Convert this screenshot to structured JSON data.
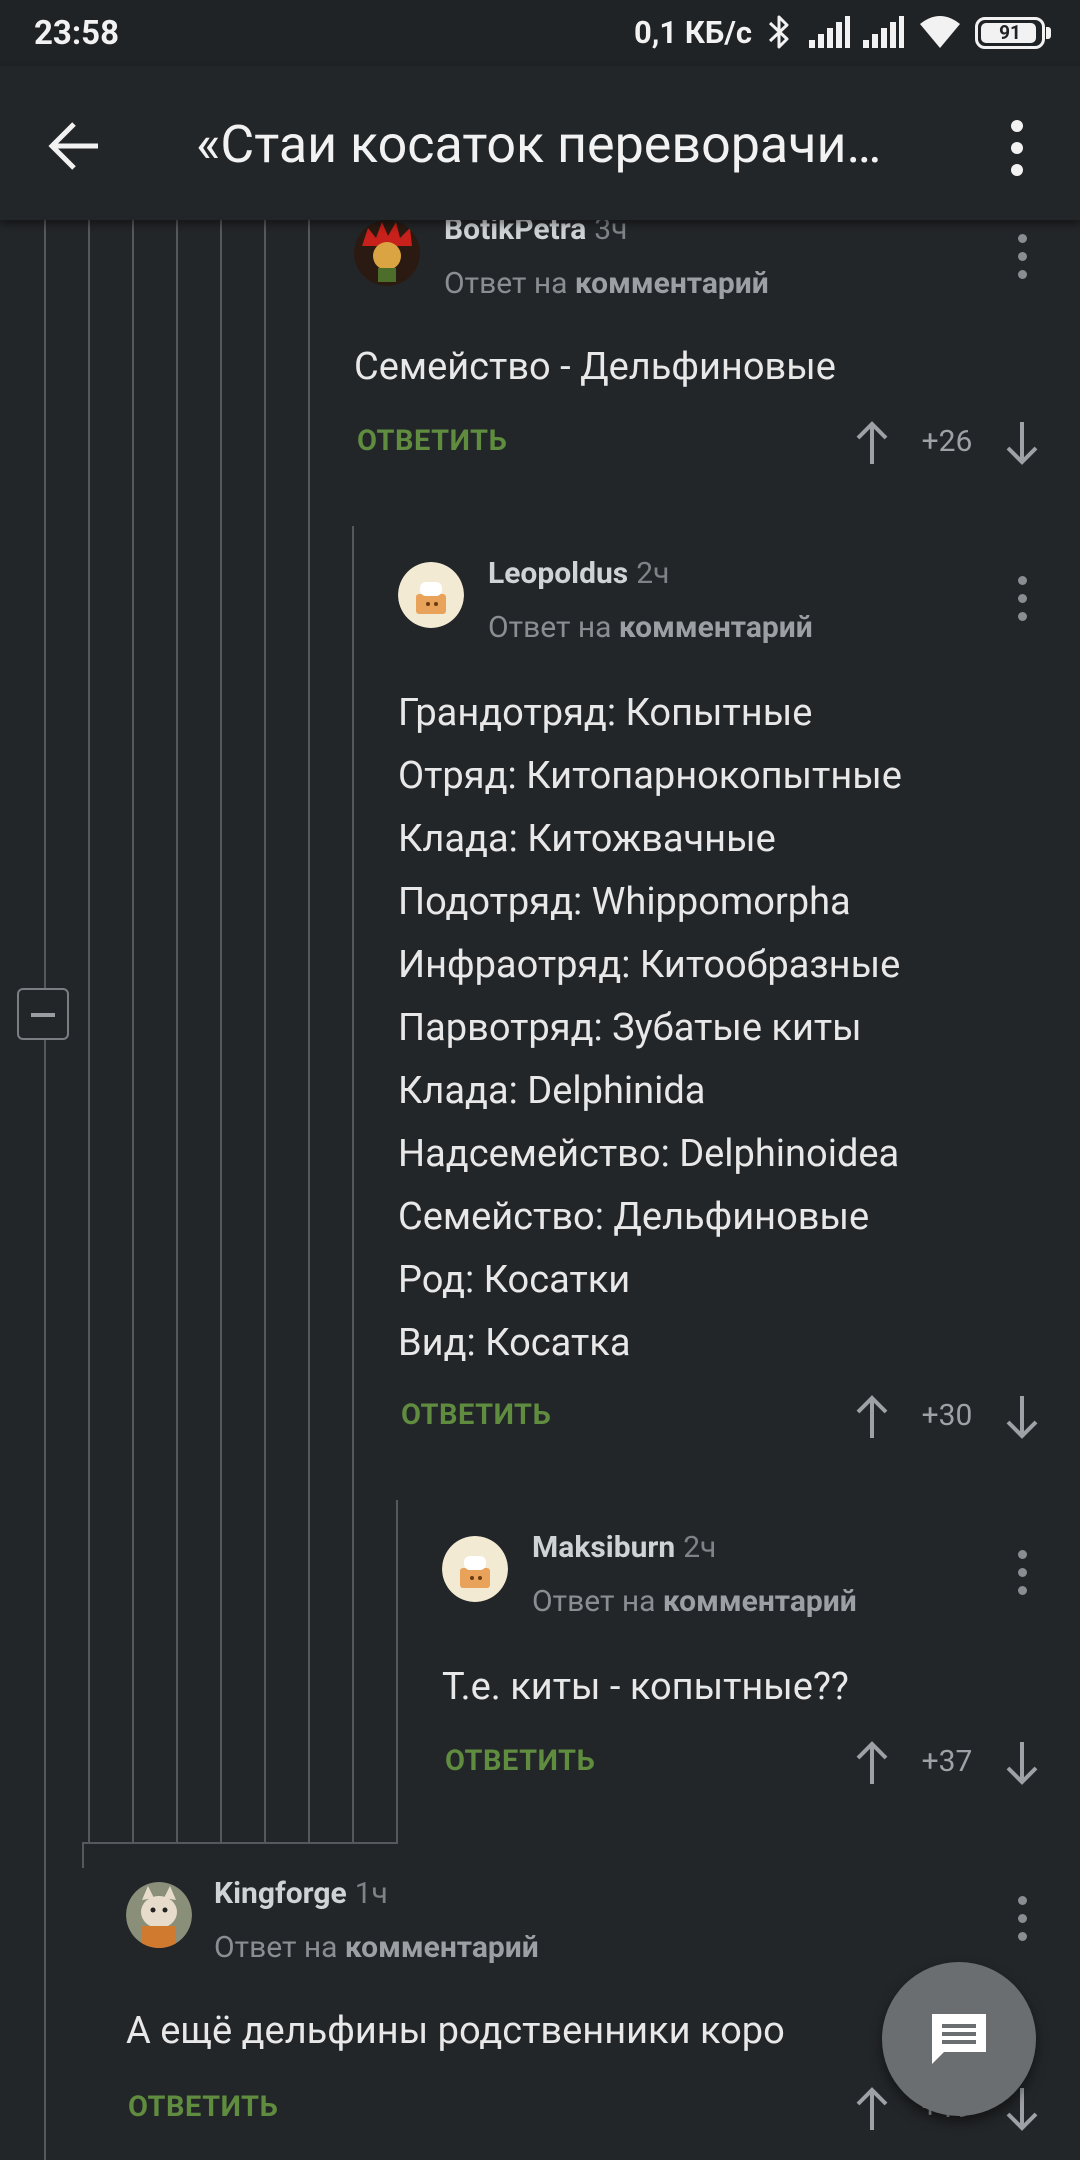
{
  "status_bar": {
    "time": "23:58",
    "network_speed": "0,1 КБ/с",
    "battery_level": "91"
  },
  "app_bar": {
    "title": "«Стаи косаток переворачи…"
  },
  "comments": [
    {
      "author": "BotikPetra",
      "time": "3ч",
      "reply_prefix": "Ответ на",
      "reply_target": "комментарий",
      "lines": [
        "Семейство - Дельфиновые"
      ],
      "reply_label": "ОТВЕТИТЬ",
      "score": "+26"
    },
    {
      "author": "Leopoldus",
      "time": "2ч",
      "reply_prefix": "Ответ на",
      "reply_target": "комментарий",
      "lines": [
        "Грандотряд: Копытные",
        "Отряд: Китопарнокопытные",
        "Клада: Китожвачные",
        "Подотряд: Whippomorpha",
        "Инфраотряд: Китообразные",
        "Парвотряд: Зубатые киты",
        "Клада: Delphinida",
        "Надсемейство: Delphinoidea",
        "Семейство: Дельфиновые",
        "Род: Косатки",
        "Вид: Косатка"
      ],
      "reply_label": "ОТВЕТИТЬ",
      "score": "+30"
    },
    {
      "author": "Maksiburn",
      "time": "2ч",
      "reply_prefix": "Ответ на",
      "reply_target": "комментарий",
      "lines": [
        "Т.е. киты - копытные??"
      ],
      "reply_label": "ОТВЕТИТЬ",
      "score": "+37"
    },
    {
      "author": "Kingforge",
      "time": "1ч",
      "reply_prefix": "Ответ на",
      "reply_target": "комментарий",
      "lines": [
        "А ещё дельфины родственники коро"
      ],
      "reply_label": "ОТВЕТИТЬ",
      "score": "+19"
    }
  ],
  "icons": {
    "back": "arrow-left-icon",
    "menu": "more-vertical-icon",
    "upvote": "arrow-up-icon",
    "downvote": "arrow-down-icon",
    "collapse": "minus-square-icon",
    "fab": "comment-icon"
  },
  "colors": {
    "background": "#232629",
    "reply_green": "#5f8c3f",
    "thread_line": "#55595d"
  }
}
